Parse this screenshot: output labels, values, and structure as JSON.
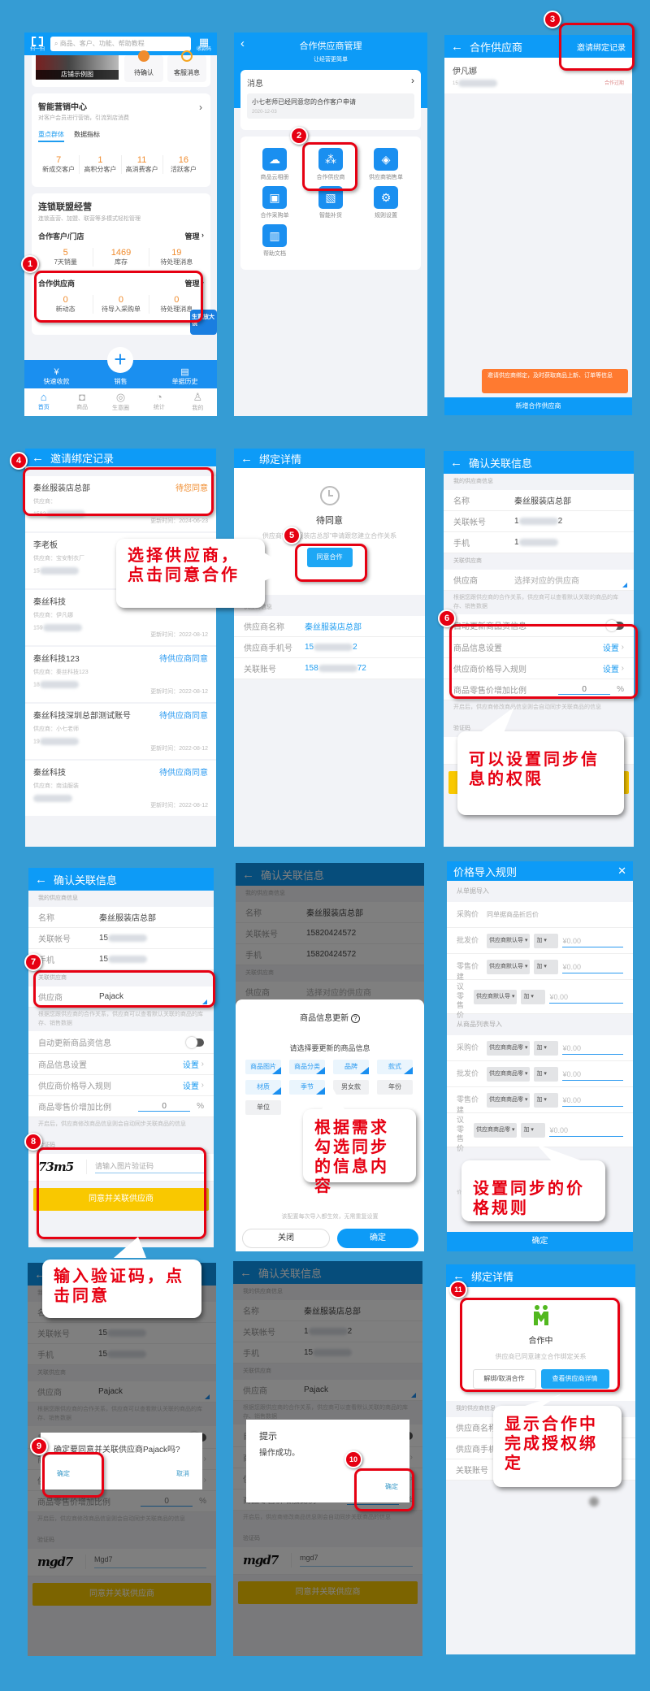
{
  "colors": {
    "background": "#359cd4",
    "header_blue": "#0d9bf7",
    "accent_orange": "#f08c2e",
    "annotation_red": "#e60012",
    "confirm_yellow": "#f9c800",
    "coop_green": "#52b81f",
    "tooltip_orange": "#ff7a30"
  },
  "steps": [
    "1",
    "2",
    "3",
    "4",
    "5",
    "6",
    "7",
    "8",
    "9",
    "10",
    "11"
  ],
  "callouts": [
    "选择供应商，点击同意合作",
    "可以设置同步信息的权限",
    "根据需求勾选同步的信息内容",
    "设置同步的价格规则",
    "输入验证码，点击同意",
    "显示合作中完成授权绑定"
  ],
  "panel1": {
    "scan_label": "扫一扫",
    "search_placeholder": "商品、客户、功能、帮助教程",
    "qr_label": "收款码",
    "store_image_label": "店铺示例图",
    "tile_pending": "待确认",
    "tile_service": "客服消息",
    "marketing": {
      "title": "智能营销中心",
      "subtitle": "对客户会员进行营销，引流到店消费",
      "tabs": [
        "重点群体",
        "数据指标"
      ],
      "stats": [
        {
          "v": "7",
          "l": "新成交客户"
        },
        {
          "v": "1",
          "l": "高积分客户"
        },
        {
          "v": "11",
          "l": "高消费客户"
        },
        {
          "v": "16",
          "l": "活跃客户"
        }
      ]
    },
    "chain": {
      "title": "连锁联盟经营",
      "subtitle": "连锁直营、加盟、联营等多模式轻松管理",
      "customers": {
        "title": "合作客户/门店",
        "manage": "管理",
        "stats": [
          {
            "v": "5",
            "l": "7天销量"
          },
          {
            "v": "1469",
            "l": "库存"
          },
          {
            "v": "19",
            "l": "待处理消息"
          }
        ]
      },
      "suppliers": {
        "title": "合作供应商",
        "manage": "管理",
        "stats": [
          {
            "v": "0",
            "l": "新动态"
          },
          {
            "v": "0",
            "l": "待导入采购单"
          },
          {
            "v": "0",
            "l": "待处理消息"
          }
        ]
      }
    },
    "float_badge": "生意放大镜",
    "bottom": {
      "quick": "快速收款",
      "sale": "销售",
      "history": "单据历史"
    },
    "tabs": [
      "首页",
      "商品",
      "生意圈",
      "统计",
      "我的"
    ]
  },
  "panel2": {
    "title": "合作供应商管理",
    "subtitle": "让经营更简单",
    "message_title": "消息",
    "message_text": "小七老师已经同意您的合作客户申请",
    "message_date": "2020-12-03",
    "grid": [
      "商品云相册",
      "合作供应商",
      "供应商销售单",
      "合作采购单",
      "智能补货",
      "规则设置",
      "帮助文档"
    ]
  },
  "panel3": {
    "title": "合作供应商",
    "invite_record": "邀请绑定记录",
    "supplier_name": "伊凡娜",
    "phone_prefix": "15",
    "status": "合作过期",
    "tooltip": "邀请供应商绑定，及时获取商品上新、订单等信息",
    "add_button": "新增合作供应商"
  },
  "panel4": {
    "title": "邀请绑定记录",
    "time_label": "更新时间：",
    "supplier_label": "供应商：",
    "items": [
      {
        "name": "秦丝服装店总部",
        "status": "待您同意",
        "pending_you": true,
        "supplier": "",
        "phone_prefix": "1582",
        "time": "2024-06-23"
      },
      {
        "name": "李老板",
        "status": "待供应商同意",
        "pending_you": false,
        "supplier": "宝安制衣厂",
        "phone_prefix": "15",
        "time": ""
      },
      {
        "name": "秦丝科技",
        "status": "",
        "pending_you": false,
        "supplier": "伊凡娜",
        "phone_prefix": "159",
        "time": "2022-08-12"
      },
      {
        "name": "秦丝科技123",
        "status": "待供应商同意",
        "pending_you": false,
        "supplier": "秦丝科技123",
        "phone_prefix": "18",
        "time": "2022-08-12"
      },
      {
        "name": "秦丝科技深圳总部测试账号",
        "status": "待供应商同意",
        "pending_you": false,
        "supplier": "小七老师",
        "phone_prefix": "19",
        "time": "2022-08-12"
      },
      {
        "name": "秦丝科技",
        "status": "待供应商同意",
        "pending_you": false,
        "supplier": "南油服装",
        "phone_prefix": "",
        "time": "2022-08-12"
      }
    ]
  },
  "panel5": {
    "title": "绑定详情",
    "state": "待同意",
    "desc": "供应商“秦丝服装店总部”申请跟您建立合作关系",
    "agree_button": "同意合作",
    "section": "供应商信息",
    "name_label": "供应商名称",
    "name_value": "秦丝服装店总部",
    "phone_label": "供应商手机号",
    "phone_prefix": "15",
    "phone_suffix": "2",
    "account_label": "关联账号",
    "account_prefix": "158",
    "account_suffix": "72"
  },
  "form_labels": {
    "title": "确认关联信息",
    "section_my": "我的供应商信息",
    "name": "名称",
    "account": "关联帐号",
    "phone": "手机",
    "section_link": "关联供应商",
    "supplier": "供应商",
    "supplier_placeholder": "选择对应的供应商",
    "link_note": "根据您跟供应商的合作关系，供应商可以查看默认关联的商品的库存、销售数据",
    "auto_update": "自动更新商品资信息",
    "info_setting": "商品信息设置",
    "price_rule": "供应商价格导入规则",
    "set": "设置",
    "retail_ratio": "商品零售价增加比例",
    "percent": "%",
    "auto_note": "开启后，供应商修改商品信息则会自动同步关联商品的信息",
    "captcha_section": "验证码",
    "captcha_placeholder": "请输入图片验证码",
    "submit": "同意并关联供应商"
  },
  "panel6": {
    "name_value": "秦丝服装店总部",
    "account_prefix": "1",
    "account_suffix": "2",
    "phone_prefix": "1",
    "supplier_value": "",
    "ratio": "0",
    "captcha_image": "",
    "captcha_value": ""
  },
  "panel7": {
    "name_value": "秦丝服装店总部",
    "account_prefix": "15",
    "account_suffix": "",
    "phone_prefix": "15",
    "supplier_value": "Pajack",
    "ratio": "0",
    "captcha_image": "73m5",
    "captcha_value": ""
  },
  "panel8": {
    "name_value": "秦丝服装店总部",
    "account_value": "15820424572",
    "phone_value": "15820424572",
    "sheet_title": "商品信息更新",
    "sheet_subtitle": "请选择要更新的商品信息",
    "chips": [
      {
        "label": "商品图片",
        "checked": true
      },
      {
        "label": "商品分类",
        "checked": true
      },
      {
        "label": "品牌",
        "checked": true
      },
      {
        "label": "款式",
        "checked": true
      },
      {
        "label": "材质",
        "checked": true
      },
      {
        "label": "季节",
        "checked": true
      },
      {
        "label": "男女款",
        "checked": false
      },
      {
        "label": "年份",
        "checked": false
      },
      {
        "label": "单位",
        "checked": false
      }
    ],
    "sheet_note": "该配置每次导入都生效，无需重复设置",
    "close": "关闭",
    "confirm": "确定"
  },
  "panel9": {
    "title": "价格导入规则",
    "from_doc": "从单据导入",
    "purchase": "采购价",
    "purchase_doc_value": "同单据商品折后价",
    "from_list": "从商品列表导入",
    "op": "加",
    "amount_placeholder": "¥0.00",
    "doc_rows": [
      {
        "label": "批发价",
        "source": "供应商默认导"
      },
      {
        "label": "零售价",
        "source": "供应商默认导"
      },
      {
        "label": "建议零售价",
        "source": "供应商默认导"
      }
    ],
    "list_rows": [
      {
        "label": "采购价",
        "source": "供应商商品零"
      },
      {
        "label": "批发价",
        "source": "供应商商品零"
      },
      {
        "label": "零售价",
        "source": "供应商商品零"
      },
      {
        "label": "建议零售价",
        "source": "供应商商品零"
      }
    ],
    "footer_note": "价格。【供应商默认导入价】由供应商设定，可能存在供应",
    "confirm": "确定"
  },
  "panel10": {
    "name_value": "秦丝服装店总部",
    "account_prefix": "15",
    "account_suffix": "",
    "phone_prefix": "15",
    "supplier_value": "Pajack",
    "ratio": "0",
    "captcha_image": "mgd7",
    "captcha_value": "Mgd7",
    "dialog_text": "确定要同意并关联供应商Pajack吗?",
    "dialog_ok": "确定",
    "dialog_cancel": "取消"
  },
  "panel11": {
    "name_value": "秦丝服装店总部",
    "account_prefix": "1",
    "account_suffix": "2",
    "phone_prefix": "15",
    "supplier_value": "Pajack",
    "ratio": "0",
    "captcha_image": "mgd7",
    "captcha_value": "mgd7",
    "dialog_title": "提示",
    "dialog_text": "操作成功。",
    "dialog_ok": "确定"
  },
  "panel12": {
    "title": "绑定详情",
    "state": "合作中",
    "desc": "供应商已同意建立合作绑定关系",
    "unbind": "解绑/取消合作",
    "view": "查看供应商详情",
    "section": "我的供应商信息",
    "rows": [
      "供应商名称",
      "供应商手机号",
      "关联账号"
    ]
  }
}
